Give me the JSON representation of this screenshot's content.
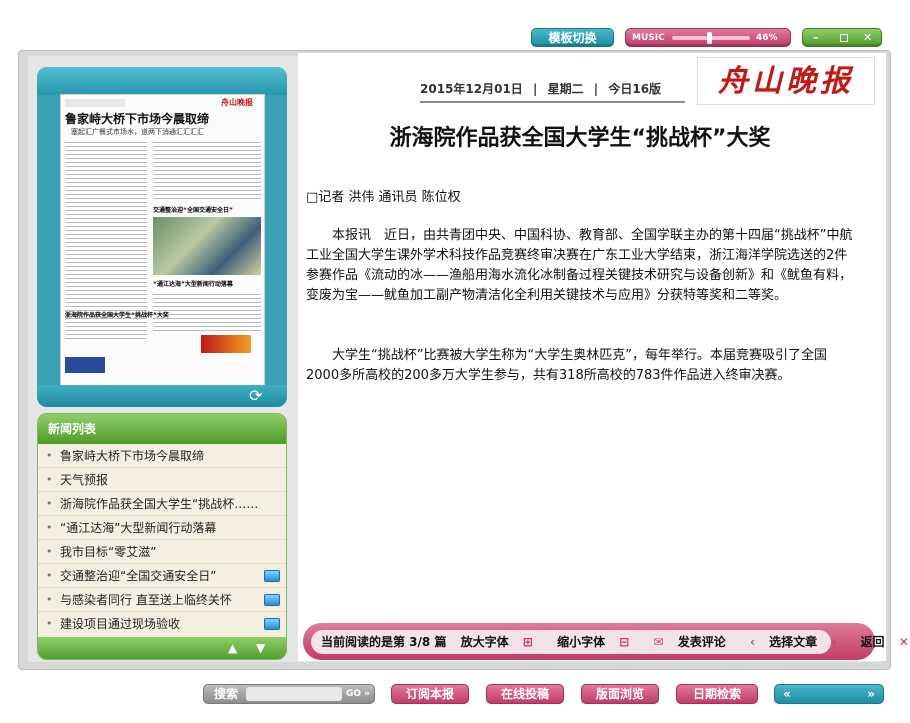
{
  "top": {
    "template_switch": "模板切换",
    "music_label": "MUSIC",
    "music_volume": "46%",
    "volume_fraction": 0.46
  },
  "header": {
    "date": "2015年12月01日",
    "weekday": "星期二",
    "page_count": "今日16版",
    "logo": "舟山晚报"
  },
  "thumb": {
    "headline": "鲁家峙大桥下市场今晨取缔",
    "subheadline": "塞起汇广餐式市场水，道两下消通汇汇汇汇",
    "block1": "交通整治迎“全国交通安全日”",
    "block2": "“通江达海”大型新闻行动落幕",
    "block3": "浙海院作品获全国大学生“挑战杯”大奖"
  },
  "news_list": {
    "title": "新闻列表",
    "items": [
      "鲁家峙大桥下市场今晨取缔",
      "天气预报",
      "浙海院作品获全国大学生“挑战杯……",
      "“通江达海”大型新闻行动落幕",
      "我市目标“零艾滋”",
      "交通整治迎“全国交通安全日”",
      "与感染者同行 直至送上临终关怀",
      "建设项目通过现场验收"
    ]
  },
  "article": {
    "title": "浙海院作品获全国大学生“挑战杯”大奖",
    "byline": "□记者 洪伟 通讯员 陈位权",
    "para1": "本报讯　近日，由共青团中央、中国科协、教育部、全国学联主办的第十四届“挑战杯”中航工业全国大学生课外学术科技作品竞赛终审决赛在广东工业大学结束，浙江海洋学院选送的2件参赛作品《流动的冰——渔船用海水流化冰制备过程关键技术研究与设备创新》和《鱿鱼有料，变废为宝——鱿鱼加工副产物清洁化全利用关键技术与应用》分获特等奖和二等奖。",
    "para2": "大学生“挑战杯”比赛被大学生称为“大学生奥林匹克”，每年举行。本届竞赛吸引了全国2000多所高校的200多万大学生参与，共有318所高校的783件作品进入终审决赛。"
  },
  "reading_bar": {
    "current": "当前阅读的是第 3/8 篇",
    "font_up": "放大字体",
    "font_down": "缩小字体",
    "comment": "发表评论",
    "choose": "选择文章",
    "back": "返回"
  },
  "bottom": {
    "search_label": "搜索",
    "search_placeholder": "",
    "go": "GO »",
    "subscribe": "订阅本报",
    "submit": "在线投稿",
    "browse": "版面浏览",
    "date_search": "日期检索",
    "prev": "«",
    "next": "»"
  }
}
